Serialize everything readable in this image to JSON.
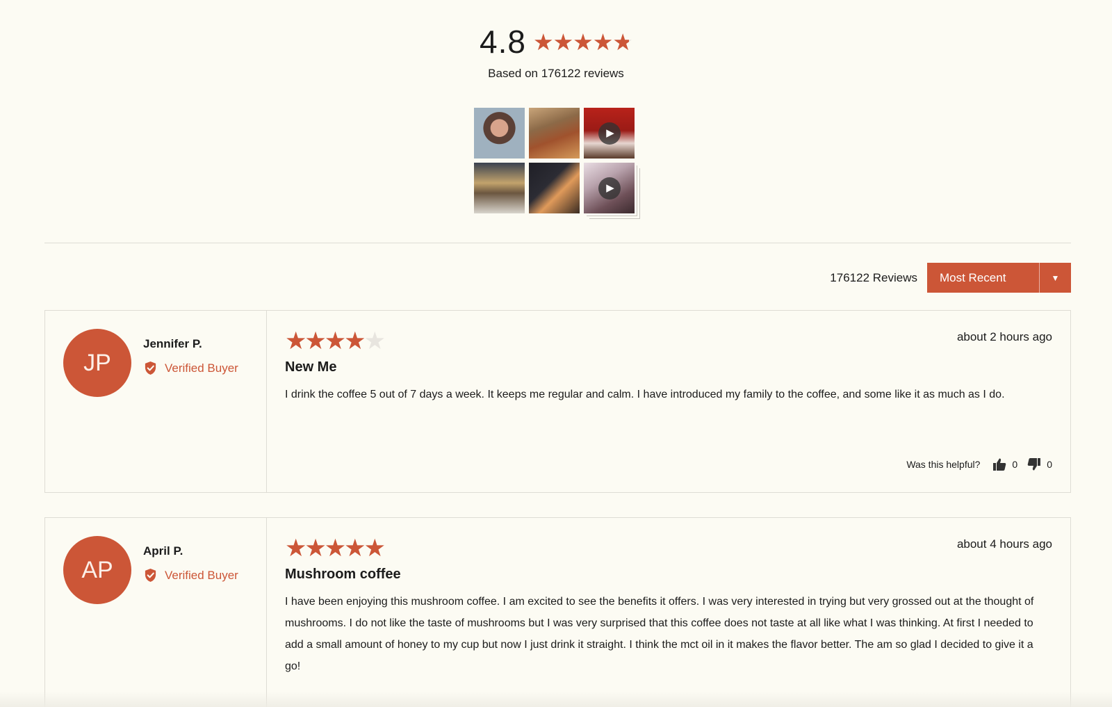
{
  "summary": {
    "average": "4.8",
    "rating": 4.8,
    "based_on": "Based on 176122 reviews"
  },
  "gallery": {
    "items": [
      {
        "type": "photo",
        "icon": null
      },
      {
        "type": "photo",
        "icon": null
      },
      {
        "type": "video",
        "icon": "play-icon"
      },
      {
        "type": "photo",
        "icon": null
      },
      {
        "type": "photo",
        "icon": null
      },
      {
        "type": "video",
        "icon": "play-icon"
      }
    ]
  },
  "toolbar": {
    "review_count": "176122 Reviews",
    "sort_label": "Most Recent",
    "sort_icon": "caret-down-icon"
  },
  "colors": {
    "accent": "#cc5637",
    "background": "#fcfbf3",
    "empty_star": "#e8e5df"
  },
  "reviews": [
    {
      "initials": "JP",
      "name": "Jennifer P.",
      "badge": "Verified Buyer",
      "rating": 4,
      "date": "about 2 hours ago",
      "title": "New Me",
      "body": "I drink the coffee 5 out of 7 days a week. It keeps me regular and calm. I have introduced my family to the coffee, and some like it as much as I do.",
      "helpful_label": "Was this helpful?",
      "up_votes": "0",
      "down_votes": "0"
    },
    {
      "initials": "AP",
      "name": "April P.",
      "badge": "Verified Buyer",
      "rating": 5,
      "date": "about 4 hours ago",
      "title": "Mushroom coffee",
      "body": "I have been enjoying this mushroom coffee. I am excited to see the benefits it offers. I was very interested in trying but very grossed out at the thought of mushrooms. I do not like the taste of mushrooms but I was very surprised that this coffee does not taste at all like what I was thinking. At first I needed to add a small amount of honey to my cup but now I just drink it straight. I think the mct oil in it makes the flavor better. The am so glad I decided to give it a go!"
    }
  ]
}
